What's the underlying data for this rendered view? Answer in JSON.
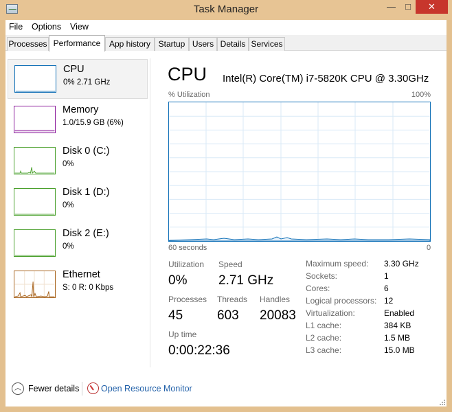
{
  "window": {
    "title": "Task Manager",
    "controls": {
      "minimize": "—",
      "maximize": "□",
      "close": "✕"
    }
  },
  "menu": [
    "File",
    "Options",
    "View"
  ],
  "tabs": [
    "Processes",
    "Performance",
    "App history",
    "Startup",
    "Users",
    "Details",
    "Services"
  ],
  "active_tab": "Performance",
  "sidebar": [
    {
      "title": "CPU",
      "sub": "0% 2.71 GHz",
      "color": "#1170b7",
      "selected": true,
      "spark": [
        0
      ]
    },
    {
      "title": "Memory",
      "sub": "1.0/15.9 GB (6%)",
      "color": "#8b1a9b",
      "selected": false,
      "spark": [
        6
      ]
    },
    {
      "title": "Disk 0 (C:)",
      "sub": "0%",
      "color": "#4aa02c",
      "selected": false,
      "spark": [
        0
      ]
    },
    {
      "title": "Disk 1 (D:)",
      "sub": "0%",
      "color": "#4aa02c",
      "selected": false,
      "spark": [
        0
      ]
    },
    {
      "title": "Disk 2 (E:)",
      "sub": "0%",
      "color": "#4aa02c",
      "selected": false,
      "spark": [
        0
      ]
    },
    {
      "title": "Ethernet",
      "sub": "S: 0 R: 0 Kbps",
      "color": "#a8641e",
      "selected": false,
      "spark": [
        0
      ]
    }
  ],
  "main": {
    "title": "CPU",
    "model": "Intel(R) Core(TM) i7-5820K CPU @ 3.30GHz",
    "axis_label": "% Utilization",
    "axis_max": "100%",
    "time_label": "60 seconds",
    "time_end": "0",
    "graph_color": "#1170b7",
    "stats": {
      "utilization_label": "Utilization",
      "utilization": "0%",
      "speed_label": "Speed",
      "speed": "2.71 GHz",
      "processes_label": "Processes",
      "processes": "45",
      "threads_label": "Threads",
      "threads": "603",
      "handles_label": "Handles",
      "handles": "20083",
      "uptime_label": "Up time",
      "uptime": "0:00:22:36"
    },
    "info": [
      {
        "label": "Maximum speed:",
        "value": "3.30 GHz"
      },
      {
        "label": "Sockets:",
        "value": "1"
      },
      {
        "label": "Cores:",
        "value": "6"
      },
      {
        "label": "Logical processors:",
        "value": "12"
      },
      {
        "label": "Virtualization:",
        "value": "Enabled"
      },
      {
        "label": "L1 cache:",
        "value": "384 KB"
      },
      {
        "label": "L2 cache:",
        "value": "1.5 MB"
      },
      {
        "label": "L3 cache:",
        "value": "15.0 MB"
      }
    ]
  },
  "footer": {
    "fewer_details": "Fewer details",
    "open_resource_monitor": "Open Resource Monitor"
  }
}
